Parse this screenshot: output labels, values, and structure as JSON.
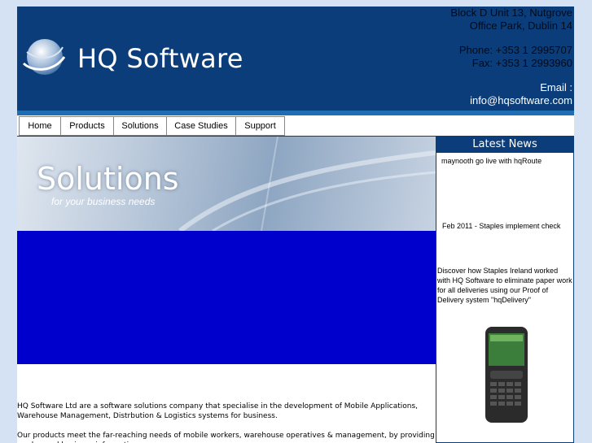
{
  "header": {
    "brand": "HQ Software",
    "address_line1": "Block D Unit 13, Nutgrove",
    "address_line2": "Office Park, Dublin 14",
    "phone": "Phone: +353 1 2995707",
    "fax": "Fax: +353 1 2993960",
    "email_label": "Email :",
    "email": "info@hqsoftware.com"
  },
  "nav": [
    {
      "label": "Home"
    },
    {
      "label": "Products"
    },
    {
      "label": "Solutions"
    },
    {
      "label": "Case Studies"
    },
    {
      "label": "Support"
    }
  ],
  "banner": {
    "title": "Solutions",
    "subtitle": "for your business  needs"
  },
  "intro": {
    "paragraph1": "HQ Software Ltd are a software solutions company that specialise in the development of Mobile Applications, Warehouse Management, Distrbution & Logistics systems for business.",
    "paragraph2": "Our products meet the far-reaching needs of mobile workers, warehouse operatives & management, by providing on-demand business information."
  },
  "news": {
    "heading": "Latest News",
    "item1": "maynooth go live with hqRoute",
    "item2": "Feb 2011 - Staples implement check",
    "item3": "Discover how Staples Ireland worked with HQ Software to eliminate paper work for all deliveries using our Proof of Delivery system \"hqDelivery\""
  },
  "colors": {
    "header_bg": "#0b3d7a",
    "body_bg": "#d4e2f3",
    "blue_block": "#0000cc"
  }
}
